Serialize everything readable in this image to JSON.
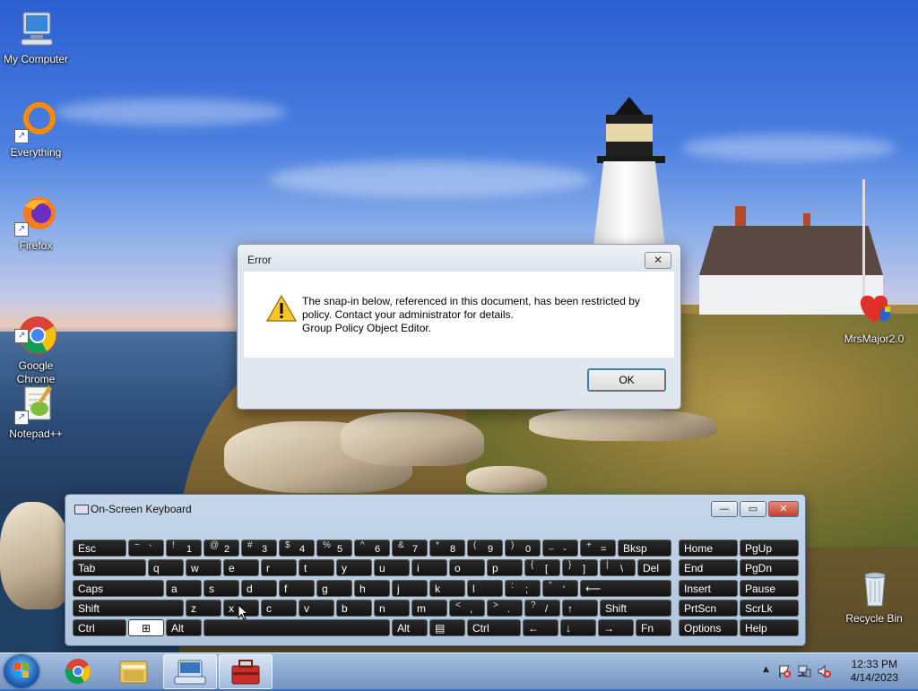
{
  "desktop": {
    "icons": [
      {
        "label": "My Computer",
        "icon": "computer-icon"
      },
      {
        "label": "Everything",
        "icon": "everything-icon"
      },
      {
        "label": "Firefox",
        "icon": "firefox-icon"
      },
      {
        "label": "Google\nChrome",
        "icon": "chrome-icon"
      },
      {
        "label": "Notepad++",
        "icon": "notepadpp-icon"
      },
      {
        "label": "MrsMajor2.0",
        "icon": "mrsmajor-icon"
      },
      {
        "label": "Recycle Bin",
        "icon": "recycle-bin-icon"
      }
    ]
  },
  "dialog": {
    "title": "Error",
    "close_label": "✕",
    "message_lines": [
      "The snap-in below, referenced in this document, has been restricted by",
      "policy. Contact your administrator for details.",
      "Group Policy Object Editor."
    ],
    "ok_label": "OK"
  },
  "osk": {
    "title": "On-Screen Keyboard",
    "minimize_label": "—",
    "restore_label": "▭",
    "close_label": "✕",
    "rows": [
      [
        {
          "label": "Esc"
        },
        {
          "top": "~",
          "bot": "`"
        },
        {
          "top": "!",
          "bot": "1"
        },
        {
          "top": "@",
          "bot": "2"
        },
        {
          "top": "#",
          "bot": "3"
        },
        {
          "top": "$",
          "bot": "4"
        },
        {
          "top": "%",
          "bot": "5"
        },
        {
          "top": "^",
          "bot": "6"
        },
        {
          "top": "&",
          "bot": "7"
        },
        {
          "top": "*",
          "bot": "8"
        },
        {
          "top": "(",
          "bot": "9"
        },
        {
          "top": ")",
          "bot": "0"
        },
        {
          "top": "_",
          "bot": "-"
        },
        {
          "top": "+",
          "bot": "="
        },
        {
          "label": "Bksp"
        }
      ],
      [
        {
          "label": "Tab"
        },
        {
          "label": "q"
        },
        {
          "label": "w"
        },
        {
          "label": "e"
        },
        {
          "label": "r"
        },
        {
          "label": "t"
        },
        {
          "label": "y"
        },
        {
          "label": "u"
        },
        {
          "label": "i"
        },
        {
          "label": "o"
        },
        {
          "label": "p"
        },
        {
          "top": "{",
          "bot": "["
        },
        {
          "top": "}",
          "bot": "]"
        },
        {
          "top": "|",
          "bot": "\\"
        },
        {
          "label": "Del"
        }
      ],
      [
        {
          "label": "Caps"
        },
        {
          "label": "a"
        },
        {
          "label": "s"
        },
        {
          "label": "d"
        },
        {
          "label": "f"
        },
        {
          "label": "g"
        },
        {
          "label": "h"
        },
        {
          "label": "j"
        },
        {
          "label": "k"
        },
        {
          "label": "l"
        },
        {
          "top": ":",
          "bot": ";"
        },
        {
          "top": "\"",
          "bot": "'"
        },
        {
          "label": "⟵"
        }
      ],
      [
        {
          "label": "Shift"
        },
        {
          "label": "z"
        },
        {
          "label": "x"
        },
        {
          "label": "c"
        },
        {
          "label": "v"
        },
        {
          "label": "b"
        },
        {
          "label": "n"
        },
        {
          "label": "m"
        },
        {
          "top": "<",
          "bot": ","
        },
        {
          "top": ">",
          "bot": "."
        },
        {
          "top": "?",
          "bot": "/"
        },
        {
          "label": "↑"
        },
        {
          "label": "Shift"
        }
      ],
      [
        {
          "label": "Ctrl"
        },
        {
          "label": "⊞"
        },
        {
          "label": "Alt"
        },
        {
          "label": ""
        },
        {
          "label": "Alt"
        },
        {
          "label": "▤"
        },
        {
          "label": "Ctrl"
        },
        {
          "label": "←"
        },
        {
          "label": "↓"
        },
        {
          "label": "→"
        },
        {
          "label": "Fn"
        }
      ]
    ],
    "nav_rows": [
      [
        "Home",
        "PgUp"
      ],
      [
        "End",
        "PgDn"
      ],
      [
        "Insert",
        "Pause"
      ],
      [
        "PrtScn",
        "ScrLk"
      ],
      [
        "Options",
        "Help"
      ]
    ]
  },
  "taskbar": {
    "items": [
      {
        "icon": "chrome-icon"
      },
      {
        "icon": "file-explorer-icon"
      },
      {
        "icon": "on-screen-keyboard-icon",
        "active": true
      },
      {
        "icon": "toolbox-icon",
        "active": true
      }
    ],
    "clock_time": "12:33 PM",
    "clock_date": "4/14/2023",
    "tray_arrow": "▲"
  }
}
